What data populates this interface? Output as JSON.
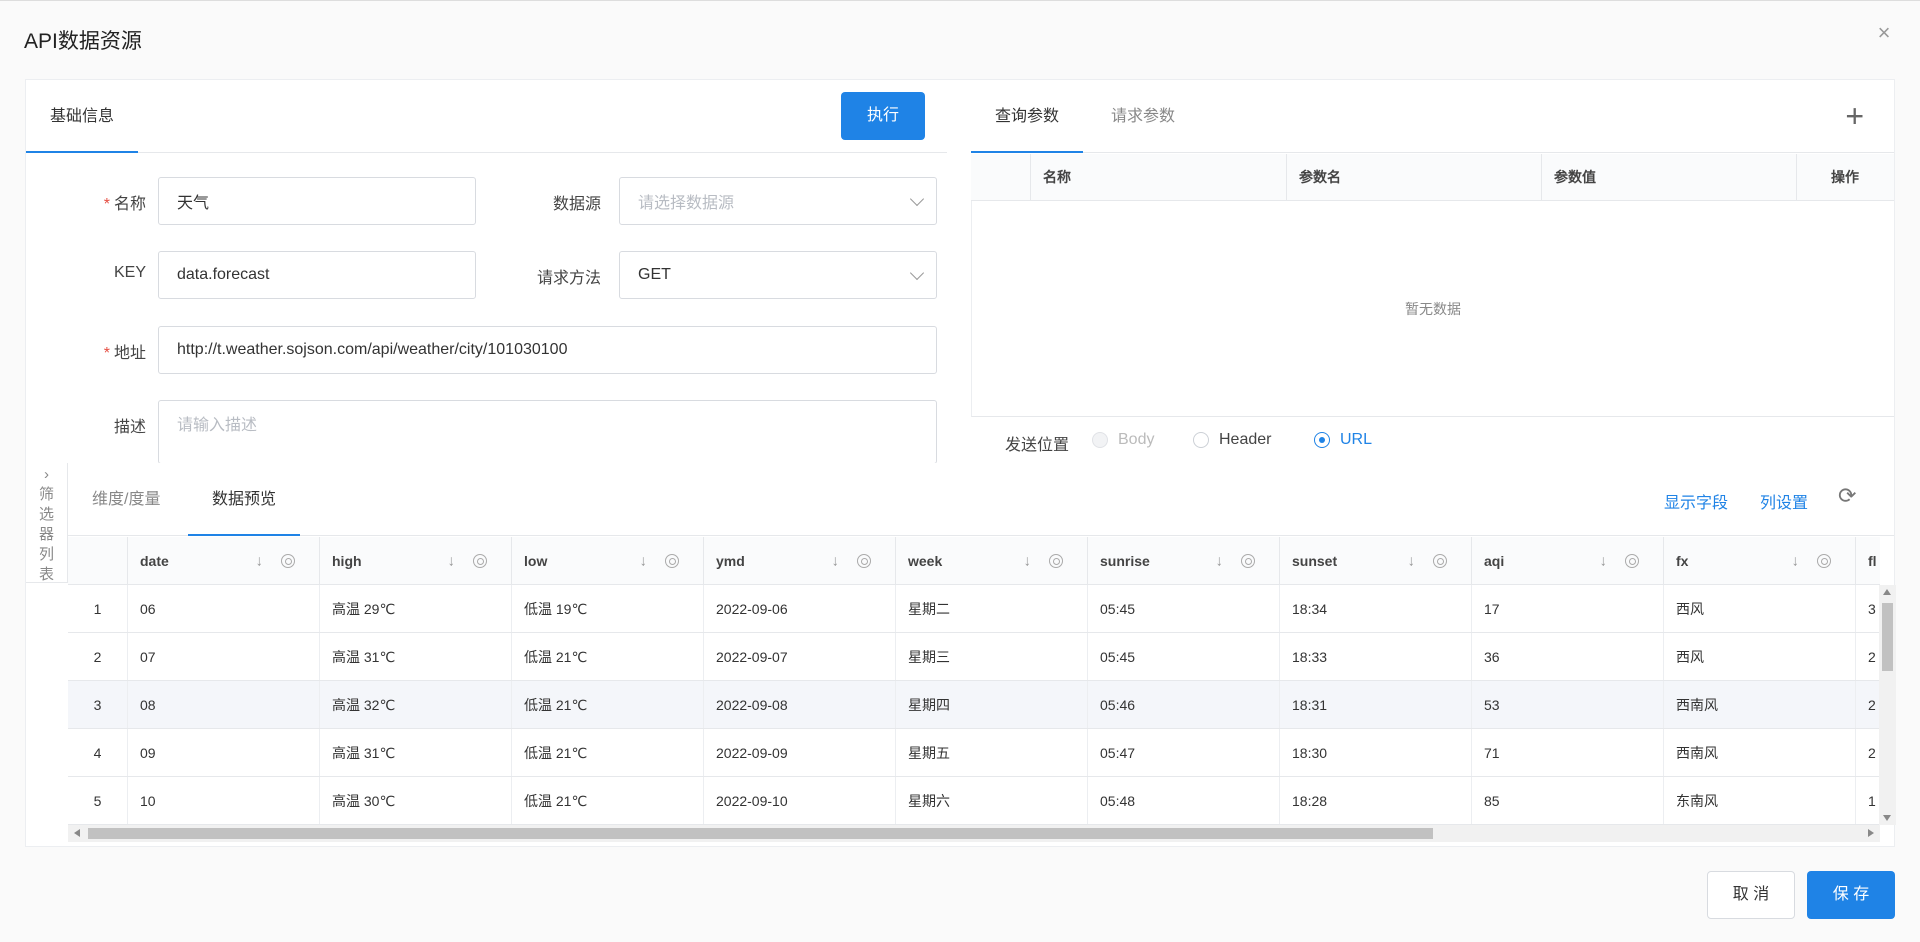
{
  "dialog": {
    "title": "API数据资源",
    "close_icon": "×"
  },
  "basic": {
    "tab_label": "基础信息",
    "execute_label": "执行",
    "name_label": "名称",
    "name_value": "天气",
    "datasource_label": "数据源",
    "datasource_placeholder": "请选择数据源",
    "key_label": "KEY",
    "key_value": "data.forecast",
    "method_label": "请求方法",
    "method_value": "GET",
    "url_label": "地址",
    "url_value": "http://t.weather.sojson.com/api/weather/city/101030100",
    "desc_label": "描述",
    "desc_placeholder": "请输入描述"
  },
  "params": {
    "tabs": [
      "查询参数",
      "请求参数"
    ],
    "add_icon": "+",
    "columns": [
      "名称",
      "参数名",
      "参数值",
      "操作"
    ],
    "empty_text": "暂无数据",
    "send_label": "发送位置",
    "send_options": [
      "Body",
      "Header",
      "URL"
    ]
  },
  "preview": {
    "side_label": [
      "筛",
      "选",
      "器",
      "列",
      "表"
    ],
    "side_arrow": "›",
    "tabs": [
      "维度/度量",
      "数据预览"
    ],
    "show_fields": "显示字段",
    "column_settings": "列设置",
    "refresh_icon": "⟳",
    "columns": [
      "date",
      "high",
      "low",
      "ymd",
      "week",
      "sunrise",
      "sunset",
      "aqi",
      "fx",
      "fl"
    ],
    "rows": [
      [
        "1",
        "06",
        "高温 29℃",
        "低温 19℃",
        "2022-09-06",
        "星期二",
        "05:45",
        "18:34",
        "17",
        "西风",
        "3"
      ],
      [
        "2",
        "07",
        "高温 31℃",
        "低温 21℃",
        "2022-09-07",
        "星期三",
        "05:45",
        "18:33",
        "36",
        "西风",
        "2"
      ],
      [
        "3",
        "08",
        "高温 32℃",
        "低温 21℃",
        "2022-09-08",
        "星期四",
        "05:46",
        "18:31",
        "53",
        "西南风",
        "2"
      ],
      [
        "4",
        "09",
        "高温 31℃",
        "低温 21℃",
        "2022-09-09",
        "星期五",
        "05:47",
        "18:30",
        "71",
        "西南风",
        "2"
      ],
      [
        "5",
        "10",
        "高温 30℃",
        "低温 21℃",
        "2022-09-10",
        "星期六",
        "05:48",
        "18:28",
        "85",
        "东南风",
        "1"
      ]
    ]
  },
  "footer": {
    "cancel_label": "取 消",
    "save_label": "保 存"
  },
  "colors": {
    "primary": "#1f83e6",
    "required": "#e54d42"
  }
}
